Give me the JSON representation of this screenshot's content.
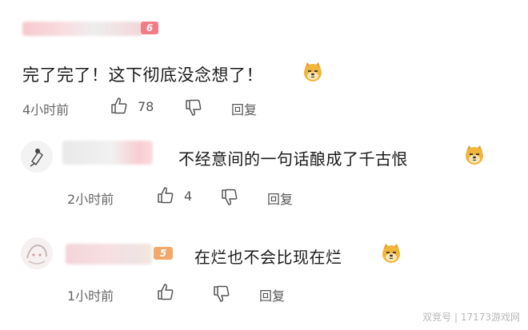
{
  "comments": [
    {
      "text": "完了完了！这下彻底没念想了！",
      "time": "4小时前",
      "likes": "78",
      "reply_label": "回复",
      "level_badge": "6"
    },
    {
      "text": "不经意间的一句话酿成了千古恨",
      "time": "2小时前",
      "likes": "4",
      "reply_label": "回复"
    },
    {
      "text": "在烂也不会比现在烂",
      "time": "1小时前",
      "reply_label": "回复",
      "level_badge": "5"
    }
  ],
  "watermark": "双竞号 | 17173游戏网",
  "icons": {
    "like": "thumbs-up-icon",
    "dislike": "thumbs-down-icon",
    "emoji": "dog-face-emoji"
  },
  "colors": {
    "badge": "#f07c85",
    "meta_text": "#666666",
    "emoji": "#f1b53a"
  }
}
